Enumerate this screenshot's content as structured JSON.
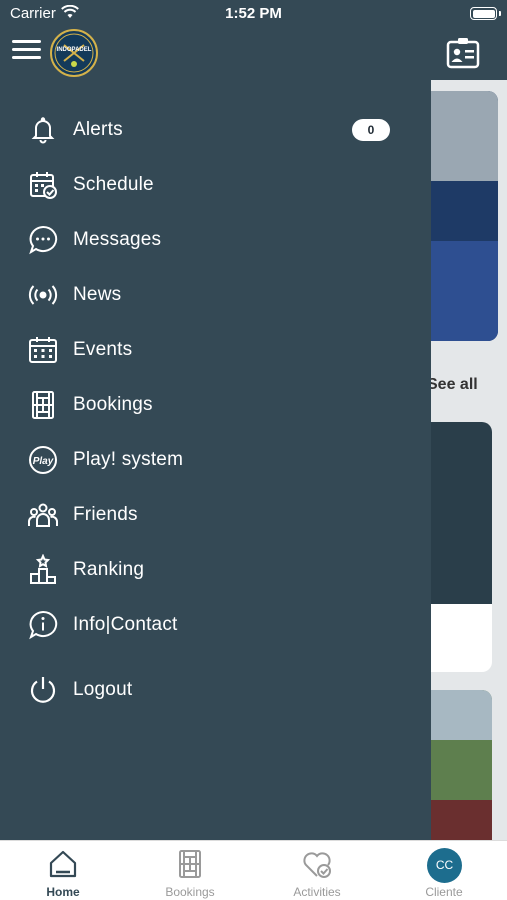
{
  "status_bar": {
    "carrier": "Carrier",
    "time": "1:52 PM"
  },
  "header": {
    "logo_text": "INDOPADEL"
  },
  "background": {
    "see_all": "See all"
  },
  "menu": {
    "alerts_count": "0",
    "items": [
      {
        "label": "Alerts",
        "icon": "bell-icon"
      },
      {
        "label": "Schedule",
        "icon": "calendar-check-icon"
      },
      {
        "label": "Messages",
        "icon": "chat-bubble-icon"
      },
      {
        "label": "News",
        "icon": "broadcast-icon"
      },
      {
        "label": "Events",
        "icon": "calendar-grid-icon"
      },
      {
        "label": "Bookings",
        "icon": "court-icon"
      },
      {
        "label": "Play! system",
        "icon": "play-badge-icon"
      },
      {
        "label": "Friends",
        "icon": "group-icon"
      },
      {
        "label": "Ranking",
        "icon": "podium-icon"
      },
      {
        "label": "Info|Contact",
        "icon": "info-bubble-icon"
      },
      {
        "label": "Logout",
        "icon": "power-icon"
      }
    ]
  },
  "tabbar": {
    "tabs": [
      {
        "label": "Home",
        "icon": "home-icon",
        "active": true
      },
      {
        "label": "Bookings",
        "icon": "court-icon",
        "active": false
      },
      {
        "label": "Activities",
        "icon": "heart-check-icon",
        "active": false
      },
      {
        "label": "Cliente",
        "icon": "avatar",
        "active": false
      }
    ],
    "avatar_initials": "CC"
  },
  "colors": {
    "drawer": "#344955",
    "tab_active": "#344955",
    "tab_inactive": "#9a9a9a",
    "avatar": "#1d6d8e"
  }
}
